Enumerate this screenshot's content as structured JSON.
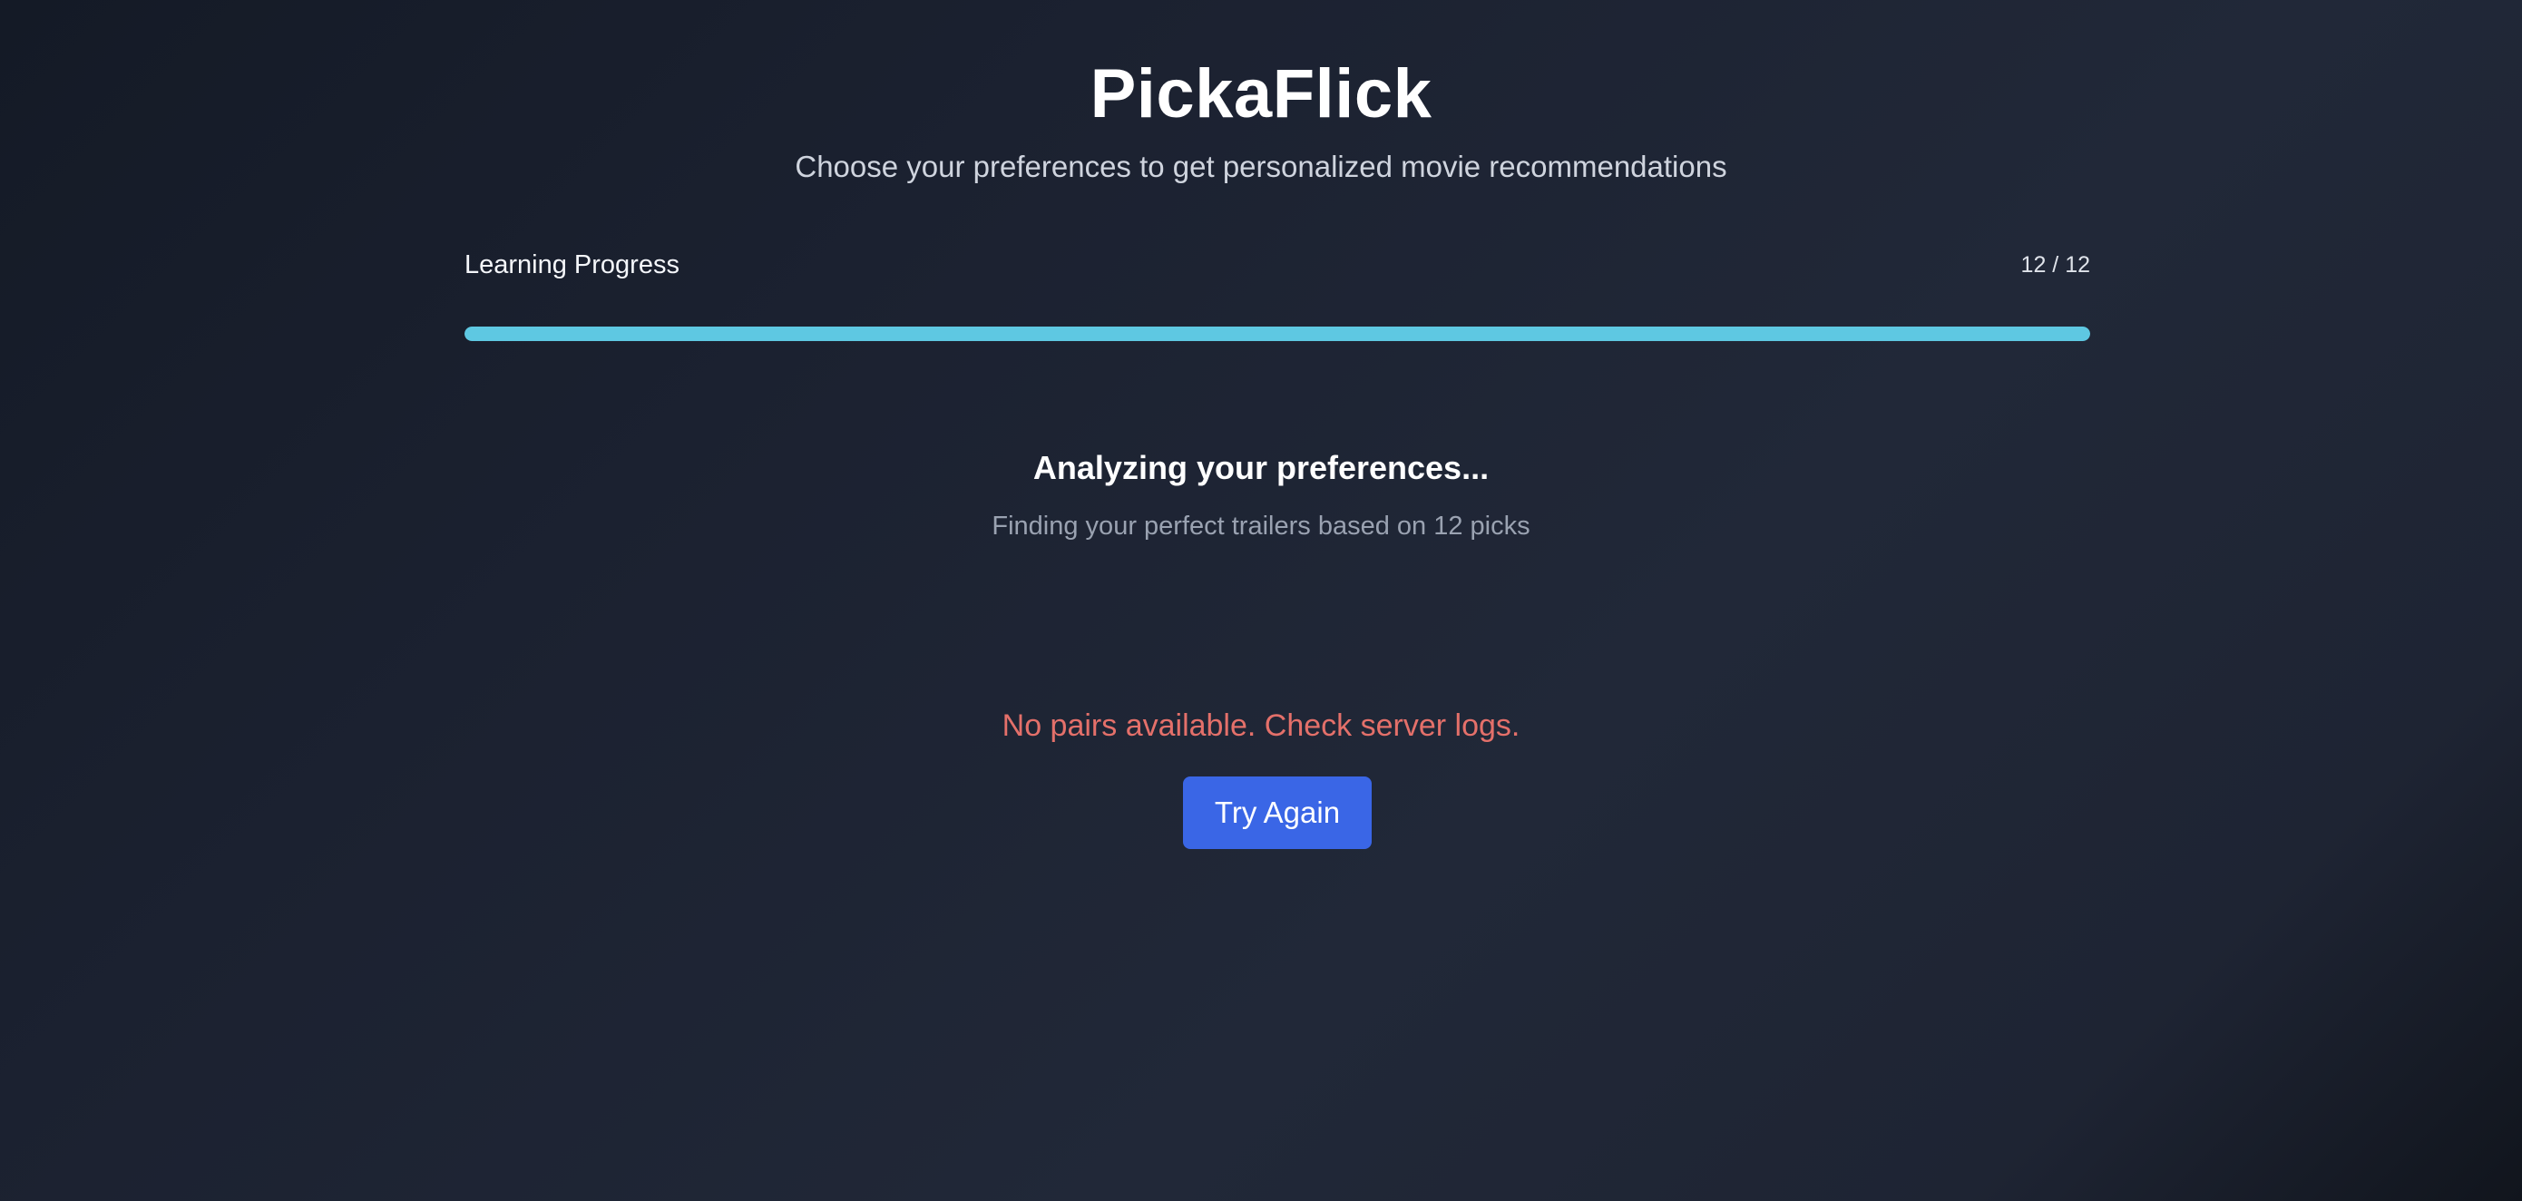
{
  "header": {
    "title": "PickaFlick",
    "subtitle": "Choose your preferences to get personalized movie recommendations"
  },
  "progress": {
    "label": "Learning Progress",
    "count_text": "12 / 12",
    "current": 12,
    "total": 12,
    "fraction": 1.0,
    "bar_color": "#5ec8e2"
  },
  "status": {
    "title": "Analyzing your preferences...",
    "subtitle": "Finding your perfect trailers based on 12 picks"
  },
  "error": {
    "message": "No pairs available. Check server logs.",
    "color": "#e4706a"
  },
  "actions": {
    "retry_label": "Try Again",
    "retry_color": "#3a66e6"
  }
}
